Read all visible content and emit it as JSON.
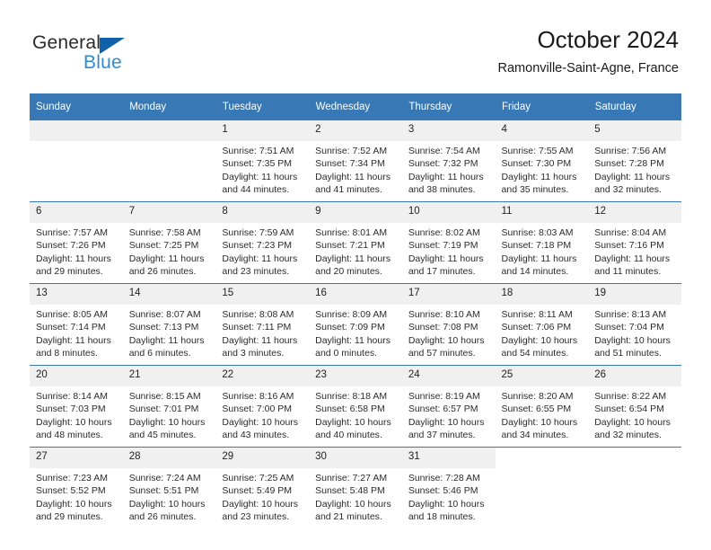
{
  "brand": {
    "name_part1": "General",
    "name_part2": "Blue",
    "triangle_color": "#1060aa",
    "blue_color": "#2e8bd4"
  },
  "header": {
    "title": "October 2024",
    "subtitle": "Ramonville-Saint-Agne, France"
  },
  "theme": {
    "header_bg": "#3878b4",
    "daynum_bg": "#f0f0f0",
    "row_divider": "#3878b4"
  },
  "weekdays": [
    "Sunday",
    "Monday",
    "Tuesday",
    "Wednesday",
    "Thursday",
    "Friday",
    "Saturday"
  ],
  "labels": {
    "sunrise_prefix": "Sunrise: ",
    "sunset_prefix": "Sunset: ",
    "daylight_prefix": "Daylight: "
  },
  "weeks": [
    [
      {
        "day": "",
        "empty": true
      },
      {
        "day": "",
        "empty": true
      },
      {
        "day": "1",
        "sunrise": "Sunrise: 7:51 AM",
        "sunset": "Sunset: 7:35 PM",
        "daylight_line1": "Daylight: 11 hours",
        "daylight_line2": "and 44 minutes."
      },
      {
        "day": "2",
        "sunrise": "Sunrise: 7:52 AM",
        "sunset": "Sunset: 7:34 PM",
        "daylight_line1": "Daylight: 11 hours",
        "daylight_line2": "and 41 minutes."
      },
      {
        "day": "3",
        "sunrise": "Sunrise: 7:54 AM",
        "sunset": "Sunset: 7:32 PM",
        "daylight_line1": "Daylight: 11 hours",
        "daylight_line2": "and 38 minutes."
      },
      {
        "day": "4",
        "sunrise": "Sunrise: 7:55 AM",
        "sunset": "Sunset: 7:30 PM",
        "daylight_line1": "Daylight: 11 hours",
        "daylight_line2": "and 35 minutes."
      },
      {
        "day": "5",
        "sunrise": "Sunrise: 7:56 AM",
        "sunset": "Sunset: 7:28 PM",
        "daylight_line1": "Daylight: 11 hours",
        "daylight_line2": "and 32 minutes."
      }
    ],
    [
      {
        "day": "6",
        "sunrise": "Sunrise: 7:57 AM",
        "sunset": "Sunset: 7:26 PM",
        "daylight_line1": "Daylight: 11 hours",
        "daylight_line2": "and 29 minutes."
      },
      {
        "day": "7",
        "sunrise": "Sunrise: 7:58 AM",
        "sunset": "Sunset: 7:25 PM",
        "daylight_line1": "Daylight: 11 hours",
        "daylight_line2": "and 26 minutes."
      },
      {
        "day": "8",
        "sunrise": "Sunrise: 7:59 AM",
        "sunset": "Sunset: 7:23 PM",
        "daylight_line1": "Daylight: 11 hours",
        "daylight_line2": "and 23 minutes."
      },
      {
        "day": "9",
        "sunrise": "Sunrise: 8:01 AM",
        "sunset": "Sunset: 7:21 PM",
        "daylight_line1": "Daylight: 11 hours",
        "daylight_line2": "and 20 minutes."
      },
      {
        "day": "10",
        "sunrise": "Sunrise: 8:02 AM",
        "sunset": "Sunset: 7:19 PM",
        "daylight_line1": "Daylight: 11 hours",
        "daylight_line2": "and 17 minutes."
      },
      {
        "day": "11",
        "sunrise": "Sunrise: 8:03 AM",
        "sunset": "Sunset: 7:18 PM",
        "daylight_line1": "Daylight: 11 hours",
        "daylight_line2": "and 14 minutes."
      },
      {
        "day": "12",
        "sunrise": "Sunrise: 8:04 AM",
        "sunset": "Sunset: 7:16 PM",
        "daylight_line1": "Daylight: 11 hours",
        "daylight_line2": "and 11 minutes."
      }
    ],
    [
      {
        "day": "13",
        "sunrise": "Sunrise: 8:05 AM",
        "sunset": "Sunset: 7:14 PM",
        "daylight_line1": "Daylight: 11 hours",
        "daylight_line2": "and 8 minutes."
      },
      {
        "day": "14",
        "sunrise": "Sunrise: 8:07 AM",
        "sunset": "Sunset: 7:13 PM",
        "daylight_line1": "Daylight: 11 hours",
        "daylight_line2": "and 6 minutes."
      },
      {
        "day": "15",
        "sunrise": "Sunrise: 8:08 AM",
        "sunset": "Sunset: 7:11 PM",
        "daylight_line1": "Daylight: 11 hours",
        "daylight_line2": "and 3 minutes."
      },
      {
        "day": "16",
        "sunrise": "Sunrise: 8:09 AM",
        "sunset": "Sunset: 7:09 PM",
        "daylight_line1": "Daylight: 11 hours",
        "daylight_line2": "and 0 minutes."
      },
      {
        "day": "17",
        "sunrise": "Sunrise: 8:10 AM",
        "sunset": "Sunset: 7:08 PM",
        "daylight_line1": "Daylight: 10 hours",
        "daylight_line2": "and 57 minutes."
      },
      {
        "day": "18",
        "sunrise": "Sunrise: 8:11 AM",
        "sunset": "Sunset: 7:06 PM",
        "daylight_line1": "Daylight: 10 hours",
        "daylight_line2": "and 54 minutes."
      },
      {
        "day": "19",
        "sunrise": "Sunrise: 8:13 AM",
        "sunset": "Sunset: 7:04 PM",
        "daylight_line1": "Daylight: 10 hours",
        "daylight_line2": "and 51 minutes."
      }
    ],
    [
      {
        "day": "20",
        "sunrise": "Sunrise: 8:14 AM",
        "sunset": "Sunset: 7:03 PM",
        "daylight_line1": "Daylight: 10 hours",
        "daylight_line2": "and 48 minutes."
      },
      {
        "day": "21",
        "sunrise": "Sunrise: 8:15 AM",
        "sunset": "Sunset: 7:01 PM",
        "daylight_line1": "Daylight: 10 hours",
        "daylight_line2": "and 45 minutes."
      },
      {
        "day": "22",
        "sunrise": "Sunrise: 8:16 AM",
        "sunset": "Sunset: 7:00 PM",
        "daylight_line1": "Daylight: 10 hours",
        "daylight_line2": "and 43 minutes."
      },
      {
        "day": "23",
        "sunrise": "Sunrise: 8:18 AM",
        "sunset": "Sunset: 6:58 PM",
        "daylight_line1": "Daylight: 10 hours",
        "daylight_line2": "and 40 minutes."
      },
      {
        "day": "24",
        "sunrise": "Sunrise: 8:19 AM",
        "sunset": "Sunset: 6:57 PM",
        "daylight_line1": "Daylight: 10 hours",
        "daylight_line2": "and 37 minutes."
      },
      {
        "day": "25",
        "sunrise": "Sunrise: 8:20 AM",
        "sunset": "Sunset: 6:55 PM",
        "daylight_line1": "Daylight: 10 hours",
        "daylight_line2": "and 34 minutes."
      },
      {
        "day": "26",
        "sunrise": "Sunrise: 8:22 AM",
        "sunset": "Sunset: 6:54 PM",
        "daylight_line1": "Daylight: 10 hours",
        "daylight_line2": "and 32 minutes."
      }
    ],
    [
      {
        "day": "27",
        "sunrise": "Sunrise: 7:23 AM",
        "sunset": "Sunset: 5:52 PM",
        "daylight_line1": "Daylight: 10 hours",
        "daylight_line2": "and 29 minutes."
      },
      {
        "day": "28",
        "sunrise": "Sunrise: 7:24 AM",
        "sunset": "Sunset: 5:51 PM",
        "daylight_line1": "Daylight: 10 hours",
        "daylight_line2": "and 26 minutes."
      },
      {
        "day": "29",
        "sunrise": "Sunrise: 7:25 AM",
        "sunset": "Sunset: 5:49 PM",
        "daylight_line1": "Daylight: 10 hours",
        "daylight_line2": "and 23 minutes."
      },
      {
        "day": "30",
        "sunrise": "Sunrise: 7:27 AM",
        "sunset": "Sunset: 5:48 PM",
        "daylight_line1": "Daylight: 10 hours",
        "daylight_line2": "and 21 minutes."
      },
      {
        "day": "31",
        "sunrise": "Sunrise: 7:28 AM",
        "sunset": "Sunset: 5:46 PM",
        "daylight_line1": "Daylight: 10 hours",
        "daylight_line2": "and 18 minutes."
      },
      {
        "day": "",
        "blank": true
      },
      {
        "day": "",
        "blank": true
      }
    ]
  ]
}
